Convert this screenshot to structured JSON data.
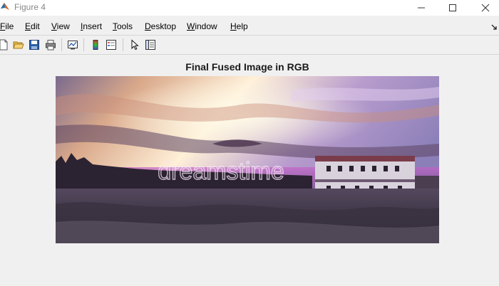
{
  "window": {
    "title": "Figure 4",
    "controls": [
      "minimize",
      "maximize",
      "close"
    ]
  },
  "menu": {
    "items": [
      {
        "first": "F",
        "rest": "ile"
      },
      {
        "first": "E",
        "rest": "dit"
      },
      {
        "first": "V",
        "rest": "iew"
      },
      {
        "first": "I",
        "rest": "nsert"
      },
      {
        "first": "T",
        "rest": "ools"
      },
      {
        "first": "D",
        "rest": "esktop"
      },
      {
        "first": "W",
        "rest": "indow"
      },
      {
        "first": "H",
        "rest": "elp"
      }
    ]
  },
  "toolbar": {
    "icons": [
      "new-figure-icon",
      "open-file-icon",
      "save-icon",
      "print-icon",
      "link-plot-icon",
      "colorbar-icon",
      "legend-icon",
      "edit-plot-icon",
      "property-inspector-icon"
    ]
  },
  "figure": {
    "title": "Final Fused Image in RGB",
    "image_description_watermark": "dreamstime"
  }
}
